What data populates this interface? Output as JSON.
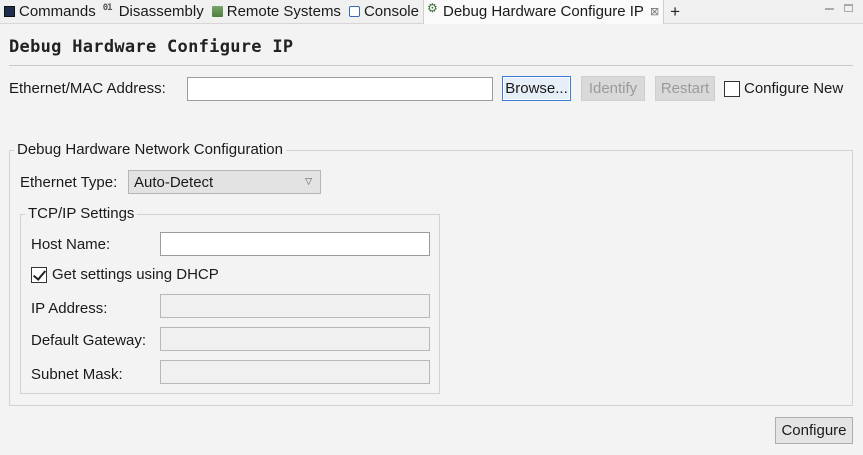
{
  "tabs": [
    {
      "label": "Commands",
      "icon": "commands-icon"
    },
    {
      "label": "Disassembly",
      "icon": "disassembly-icon"
    },
    {
      "label": "Remote Systems",
      "icon": "remote-systems-icon"
    },
    {
      "label": "Console",
      "icon": "console-icon"
    },
    {
      "label": "Debug Hardware Configure IP",
      "icon": "debug-hardware-icon",
      "active": true,
      "close": "⊠"
    }
  ],
  "tab_add": "+",
  "page_title": "Debug Hardware Configure IP",
  "mac": {
    "label": "Ethernet/MAC Address:",
    "value": "",
    "browse": "Browse...",
    "identify": "Identify",
    "restart": "Restart",
    "configure_new": "Configure New",
    "configure_new_checked": false
  },
  "network": {
    "title": "Debug Hardware Network Configuration",
    "ethernet_type_label": "Ethernet Type:",
    "ethernet_type_value": "Auto-Detect",
    "tcpip": {
      "title": "TCP/IP Settings",
      "host_name_label": "Host Name:",
      "host_name_value": "",
      "dhcp_label": "Get settings using DHCP",
      "dhcp_checked": true,
      "ip_label": "IP Address:",
      "gateway_label": "Default Gateway:",
      "subnet_label": "Subnet Mask:"
    }
  },
  "configure_button": "Configure",
  "colors": {
    "background": "#f3f3f3",
    "focus_border": "#3a7bd5",
    "disabled_text": "#9a9a9a"
  }
}
